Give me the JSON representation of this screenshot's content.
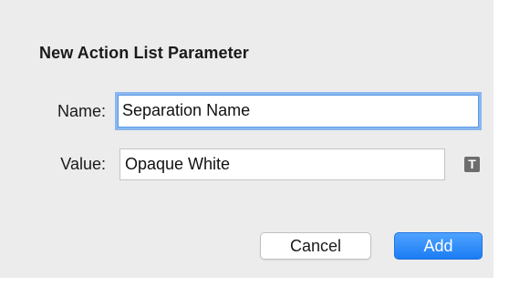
{
  "dialog": {
    "title": "New Action List Parameter"
  },
  "fields": {
    "name_label": "Name:",
    "name_value": "Separation Name",
    "value_label": "Value:",
    "value_value": "Opaque White"
  },
  "icons": {
    "type_toggle_icon": "text-type-icon",
    "type_toggle_glyph": "T"
  },
  "buttons": {
    "cancel_label": "Cancel",
    "add_label": "Add"
  },
  "colors": {
    "accent": "#1b7cf4",
    "focus_ring": "#8ab7f0",
    "sheet_background": "#ececec"
  }
}
